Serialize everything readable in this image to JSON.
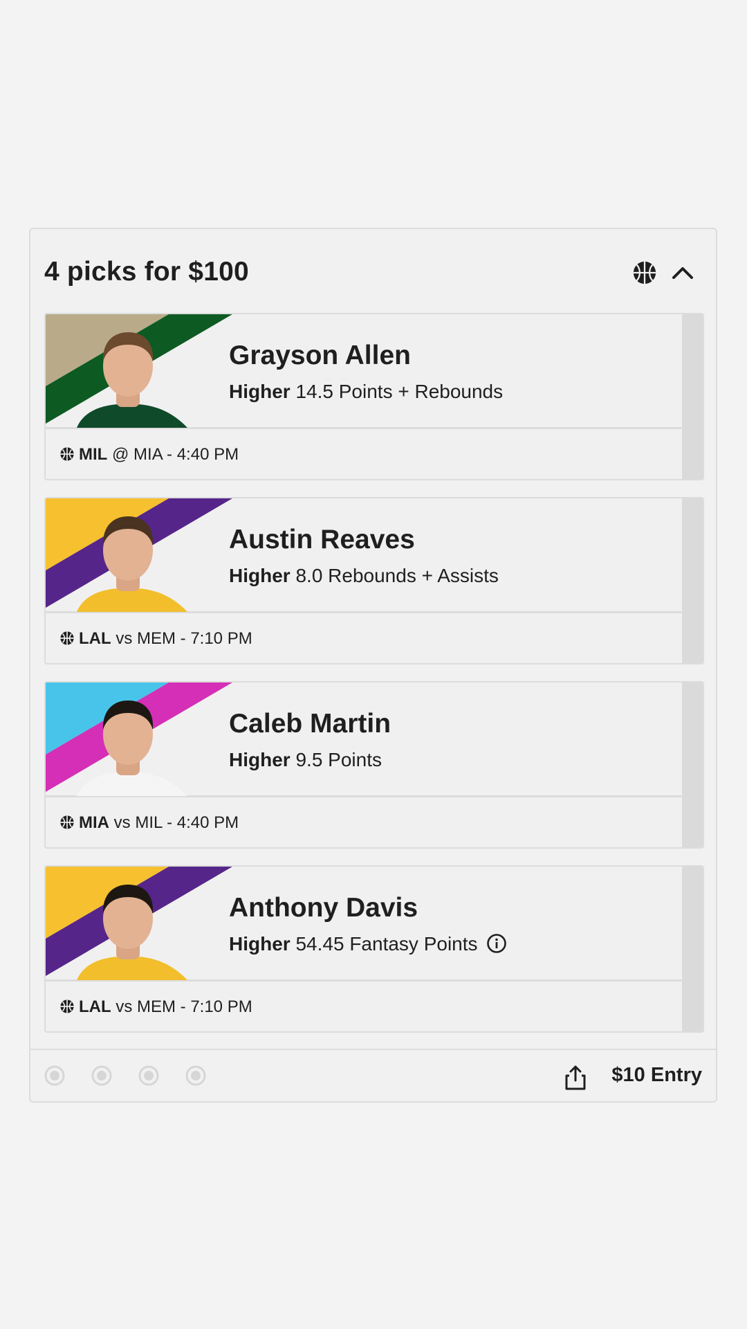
{
  "card": {
    "title": "4 picks for $100",
    "header_icons": [
      "basketball-icon",
      "chevron-up-icon"
    ]
  },
  "picks": [
    {
      "player": "Grayson Allen",
      "direction": "Higher",
      "line": "14.5 Points + Rebounds",
      "team": "MIL",
      "matchup": "@ MIA - 4:40 PM",
      "stripe_colors": [
        "#b9ab8a",
        "#0d5a23"
      ],
      "jersey_color": "#0f4a2a",
      "has_info_icon": false
    },
    {
      "player": "Austin Reaves",
      "direction": "Higher",
      "line": "8.0 Rebounds + Assists",
      "team": "LAL",
      "matchup": "vs MEM - 7:10 PM",
      "stripe_colors": [
        "#f6c02f",
        "#55258a"
      ],
      "jersey_color": "#f2be2c",
      "has_info_icon": false
    },
    {
      "player": "Caleb Martin",
      "direction": "Higher",
      "line": "9.5 Points",
      "team": "MIA",
      "matchup": "vs MIL - 4:40 PM",
      "stripe_colors": [
        "#48c4ea",
        "#d42fb6"
      ],
      "jersey_color": "#f5f5f5",
      "has_info_icon": false
    },
    {
      "player": "Anthony Davis",
      "direction": "Higher",
      "line": "54.45 Fantasy Points",
      "team": "LAL",
      "matchup": "vs MEM - 7:10 PM",
      "stripe_colors": [
        "#f6c02f",
        "#55258a"
      ],
      "jersey_color": "#f2be2c",
      "has_info_icon": true
    }
  ],
  "footer": {
    "progress_dots": 4,
    "entry_label": "$10 Entry"
  },
  "colors": {
    "background": "#f3f3f3",
    "card_border": "#dcdcdc",
    "text": "#1f1f1f"
  }
}
